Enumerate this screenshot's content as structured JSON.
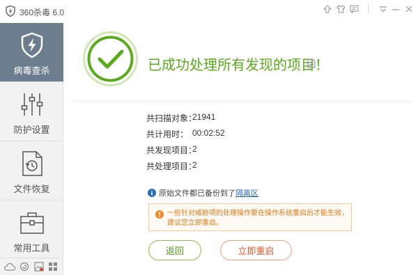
{
  "window": {
    "title": "360杀毒 6.0",
    "icons": [
      "upload-icon",
      "skin-icon",
      "feedback-icon",
      "menu-icon",
      "minimize-icon",
      "close-icon"
    ]
  },
  "sidebar": {
    "items": [
      {
        "label": "病毒查杀",
        "icon": "shield-icon",
        "active": true
      },
      {
        "label": "防护设置",
        "icon": "sliders-icon",
        "active": false
      },
      {
        "label": "文件恢复",
        "icon": "file-restore-icon",
        "active": false
      },
      {
        "label": "常用工具",
        "icon": "toolbox-icon",
        "active": false
      }
    ],
    "bottom_icons": [
      "cloud-icon",
      "refresh-icon",
      "image-icon",
      "grid-icon"
    ]
  },
  "result": {
    "headline": "已成功处理所有发现的项目！",
    "stats": [
      {
        "label": "共扫描对象：",
        "value": "21941"
      },
      {
        "label": "共计用时：",
        "value": "00:02:52"
      },
      {
        "label": "共发现项目：",
        "value": "2"
      },
      {
        "label": "共处理项目：",
        "value": "2"
      }
    ],
    "backup_note": "原始文件都已备份到了",
    "backup_link": "隔离区",
    "warning": "一些针对威胁项的处理操作要在操作系统重启后才能生效，建议您立即重启。",
    "buttons": {
      "back": "返回",
      "restart": "立即重启"
    }
  },
  "colors": {
    "success_green": "#5aab1b",
    "sidebar_active": "#6c7d8d",
    "warning_orange": "#e07a1a",
    "link_blue": "#2a6ebb"
  }
}
